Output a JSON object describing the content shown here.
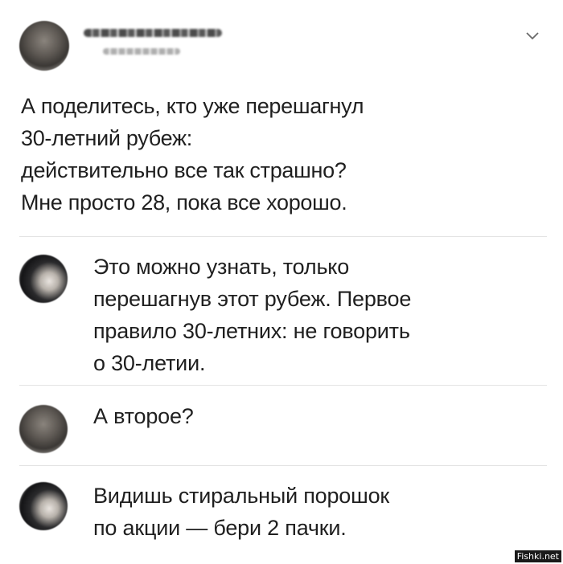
{
  "post": {
    "text_lines": [
      "А поделитесь, кто уже перешагнул",
      "30-летний рубеж:",
      "действительно все так страшно?",
      "Мне просто 28, пока все хорошо."
    ],
    "menu_icon": "chevron-down-icon"
  },
  "comments": [
    {
      "text_lines": [
        "Это можно узнать, только",
        "перешагнув этот рубеж. Первое",
        "правило 30-летних: не говорить",
        "о 30-летии."
      ]
    },
    {
      "text_lines": [
        "А второе?"
      ]
    },
    {
      "text_lines": [
        "Видишь стиральный порошок",
        "по акции — бери 2 пачки."
      ]
    }
  ],
  "watermark": "Fishki.net"
}
